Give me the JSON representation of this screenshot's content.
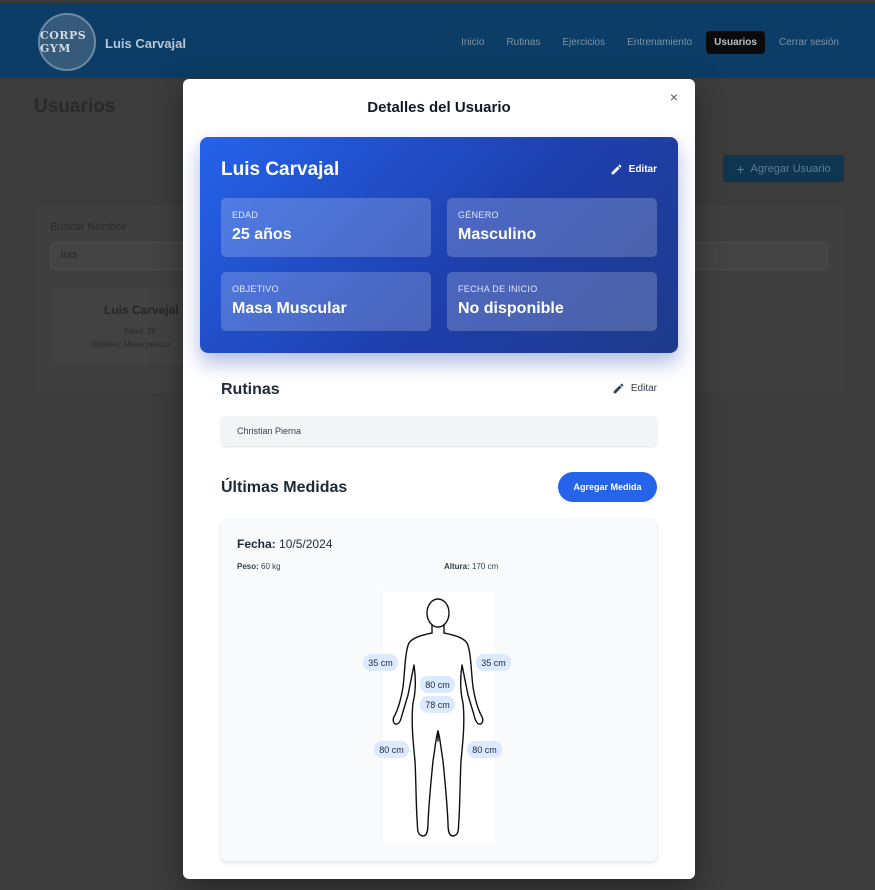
{
  "app": {
    "logo_text": "CORPS GYM",
    "brand_name": "Luis Carvajal",
    "nav": [
      "Inicio",
      "Rutinas",
      "Ejercicios",
      "Entrenamiento",
      "Usuarios",
      "Cerrar sesión"
    ],
    "active_nav": "Usuarios"
  },
  "page": {
    "title": "Usuarios",
    "add_user_label": "Agregar Usuario",
    "search_label": "Buscar Nombre",
    "search_value": "luis",
    "user_card": {
      "name": "Luis Carvajal",
      "age_line": "Edad: 25",
      "goal_line": "Objetivo: Masa muscu"
    }
  },
  "modal": {
    "title": "Detalles del Usuario",
    "close_symbol": "×",
    "profile": {
      "name": "Luis Carvajal",
      "edit_label": "Editar",
      "stats": [
        {
          "label": "EDAD",
          "value": "25 años"
        },
        {
          "label": "GÉNERO",
          "value": "Masculino"
        },
        {
          "label": "OBJETIVO",
          "value": "Masa Muscular"
        },
        {
          "label": "FECHA DE INICIO",
          "value": "No disponible"
        }
      ]
    },
    "routines": {
      "title": "Rutinas",
      "edit_label": "Editar",
      "items": [
        "Christian Pierna"
      ]
    },
    "measurements": {
      "title": "Últimas Medidas",
      "add_label": "Agregar Medida",
      "date_label": "Fecha:",
      "date_value": "10/5/2024",
      "weight_label": "Peso:",
      "weight_value": "60 kg",
      "height_label": "Altura:",
      "height_value": "170 cm",
      "body": {
        "left_arm": "35 cm",
        "right_arm": "35 cm",
        "chest": "80 cm",
        "waist": "78 cm",
        "left_leg": "80 cm",
        "right_leg": "80 cm"
      }
    }
  },
  "colors": {
    "primary": "#2563eb",
    "card_gradient_end": "#1e3a8a",
    "navbar": "#0b3d66"
  }
}
